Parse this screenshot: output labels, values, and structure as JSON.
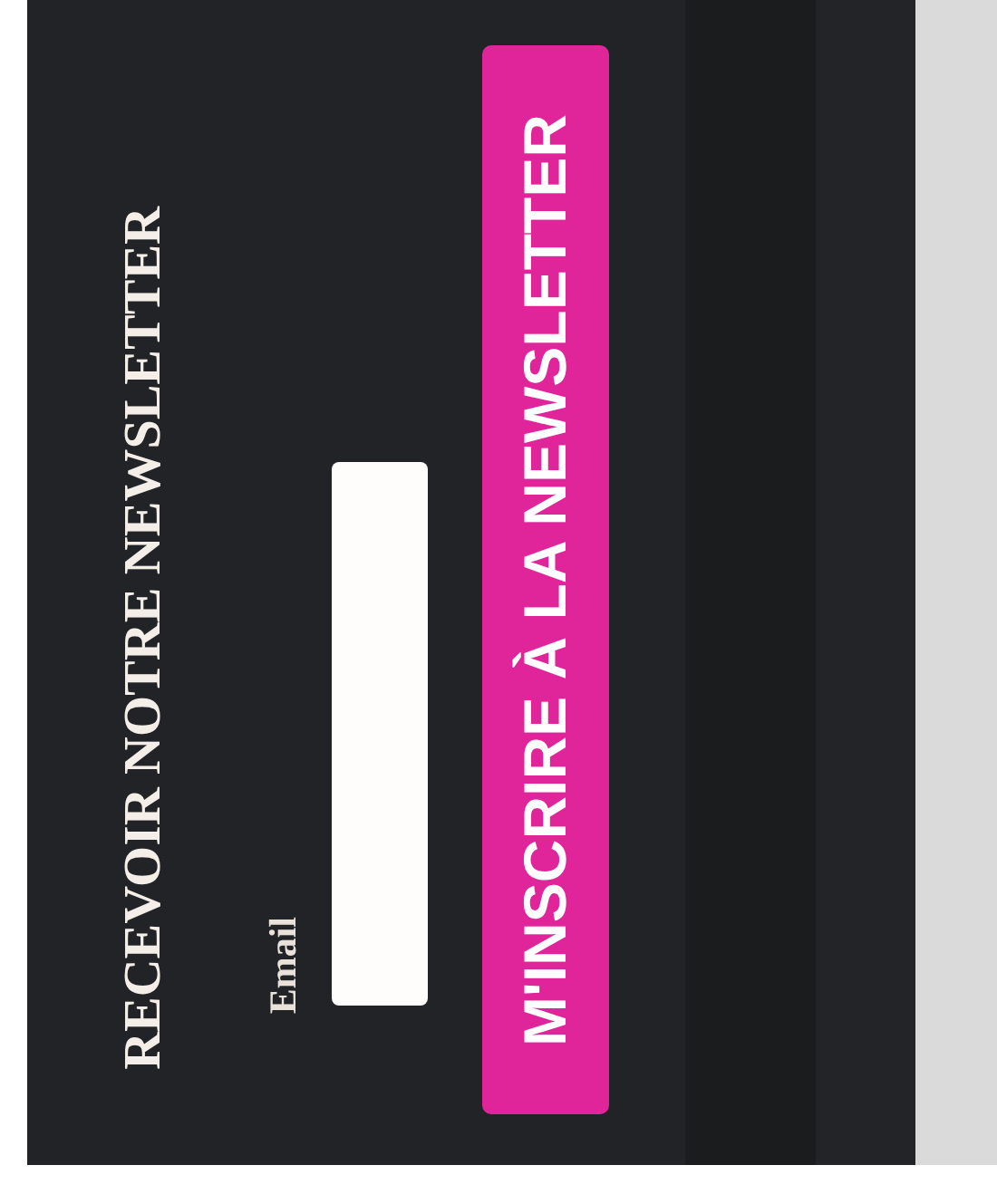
{
  "newsletter": {
    "heading": "RECEVOIR NOTRE NEWSLETTER",
    "email_label": "Email",
    "submit_button": "M'INSCRIRE À LA NEWSLETTER"
  }
}
